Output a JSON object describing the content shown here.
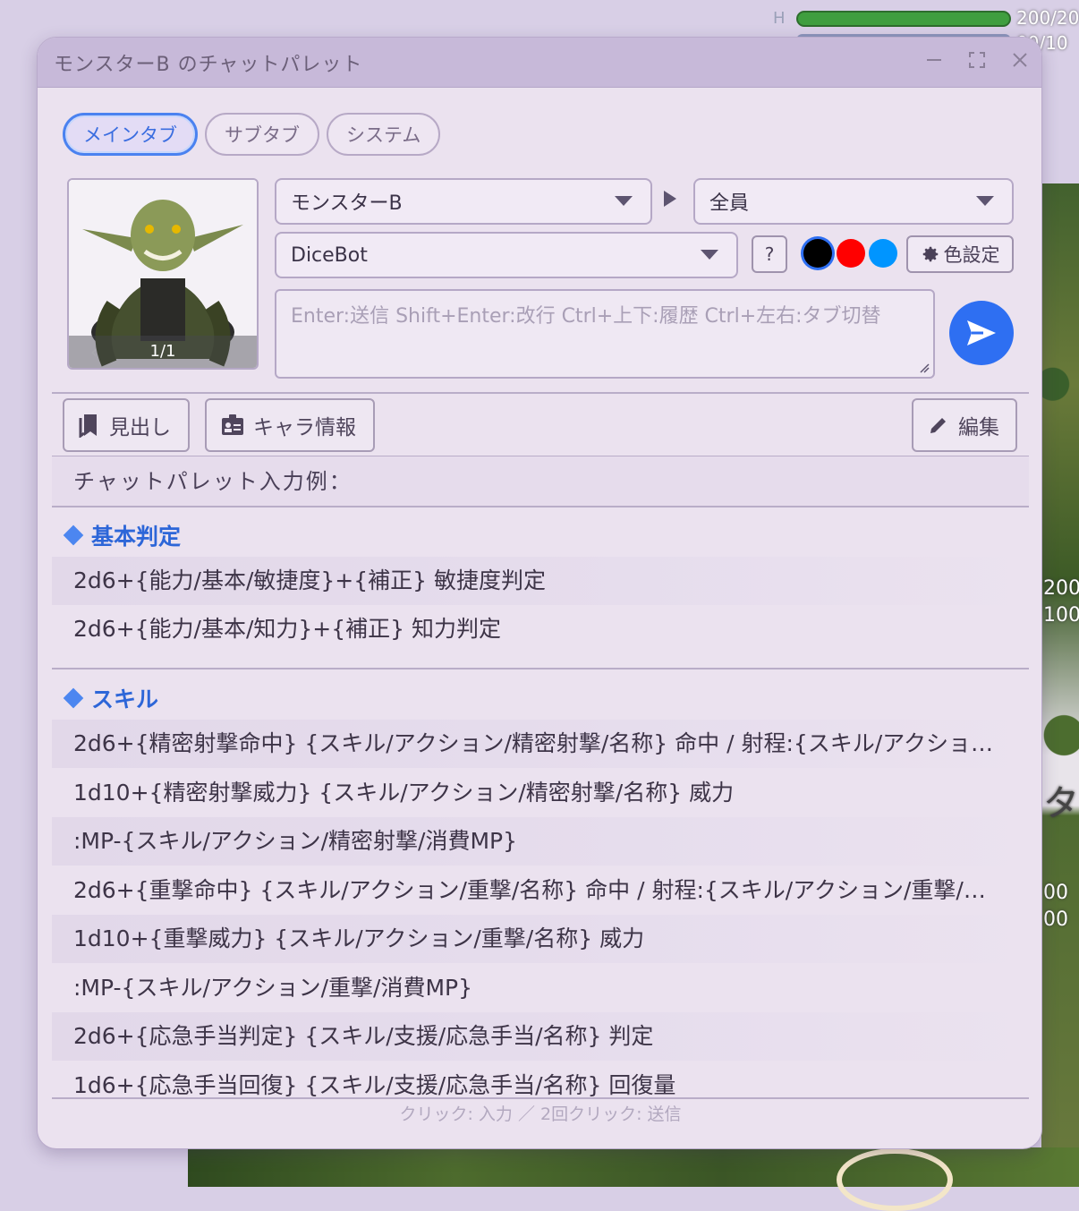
{
  "hud": {
    "label": "H",
    "hp_value": "200/20",
    "mp_value": "00/10",
    "hp_fraction": 1.0
  },
  "background_side_values": [
    "200",
    "100",
    "00",
    "00"
  ],
  "background_side_glyph": "タ",
  "window": {
    "title": "モンスターB のチャットパレット",
    "minimize_icon": "minimize-icon",
    "maximize_icon": "maximize-icon",
    "close_icon": "close-icon"
  },
  "tabs": [
    {
      "label": "メインタブ",
      "active": true
    },
    {
      "label": "サブタブ",
      "active": false
    },
    {
      "label": "システム",
      "active": false
    }
  ],
  "portrait": {
    "counter": "1/1"
  },
  "character_select": {
    "value": "モンスターB"
  },
  "target_select": {
    "value": "全員"
  },
  "system_select": {
    "value": "DiceBot"
  },
  "help_label": "?",
  "colors": {
    "swatches": [
      "#000000",
      "#ff0000",
      "#0095ff"
    ],
    "accent": "#2e6ff2",
    "settings_label": "色設定"
  },
  "chat_input": {
    "placeholder": "Enter:送信 Shift+Enter:改行 Ctrl+上下:履歴 Ctrl+左右:タブ切替"
  },
  "toolbar": {
    "headings_label": "見出し",
    "character_info_label": "キャラ情報",
    "edit_label": "編集"
  },
  "palette": {
    "header": "チャットパレット入力例：",
    "sections": [
      {
        "title": "基本判定",
        "rows": [
          "2d6+{能力/基本/敏捷度}+{補正} 敏捷度判定",
          "2d6+{能力/基本/知力}+{補正} 知力判定"
        ]
      },
      {
        "title": "スキル",
        "rows": [
          "2d6+{精密射撃命中} {スキル/アクション/精密射撃/名称} 命中 / 射程:{スキル/アクション/精密射撃/射程}",
          "1d10+{精密射撃威力} {スキル/アクション/精密射撃/名称} 威力",
          ":MP-{スキル/アクション/精密射撃/消費MP}",
          "2d6+{重撃命中} {スキル/アクション/重撃/名称} 命中 / 射程:{スキル/アクション/重撃/射程}",
          "1d10+{重撃威力} {スキル/アクション/重撃/名称} 威力",
          ":MP-{スキル/アクション/重撃/消費MP}",
          "2d6+{応急手当判定} {スキル/支援/応急手当/名称} 判定",
          "1d6+{応急手当回復} {スキル/支援/応急手当/名称} 回復量"
        ]
      }
    ],
    "footer_hint": "クリック: 入力 ／ 2回クリック: 送信"
  }
}
